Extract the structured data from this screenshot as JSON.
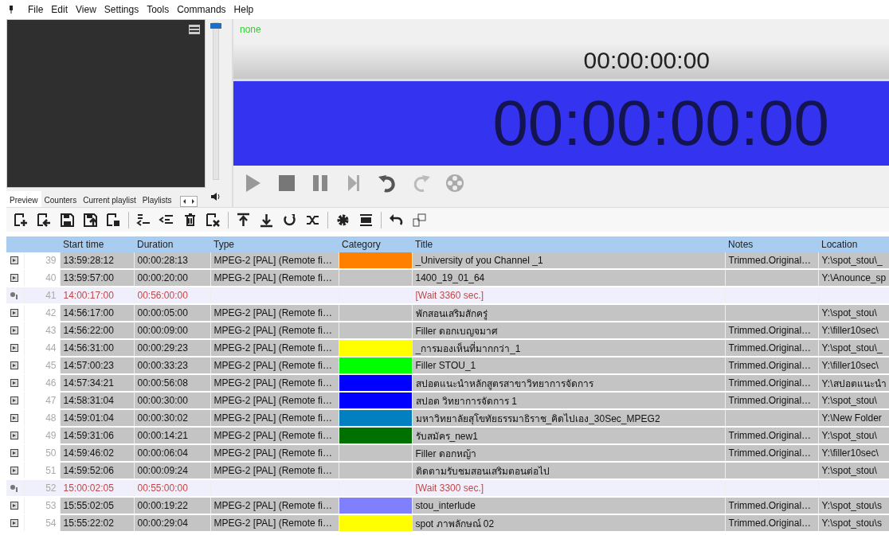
{
  "menu": [
    {
      "label": "File"
    },
    {
      "label": "Edit"
    },
    {
      "label": "View"
    },
    {
      "label": "Settings"
    },
    {
      "label": "Tools"
    },
    {
      "label": "Commands"
    },
    {
      "label": "Help"
    }
  ],
  "preview": {
    "tabs": [
      {
        "label": "Preview",
        "selected": true
      },
      {
        "label": "Counters",
        "selected": false
      },
      {
        "label": "Current playlist",
        "selected": false
      },
      {
        "label": "Playlists",
        "selected": false
      }
    ]
  },
  "volume": {
    "level": 1
  },
  "player": {
    "status": "none",
    "counter": "00:00:00:00",
    "big_counter": "00:00:00:00"
  },
  "table": {
    "columns": [
      "Start time",
      "Duration",
      "Type",
      "Category",
      "Title",
      "Notes",
      "Location"
    ],
    "rows": [
      {
        "kind": "clip",
        "number": "39",
        "start": "13:59:28:12",
        "duration": "00:00:28:13",
        "type": "MPEG-2 [PAL] (Remote fi…",
        "color": "#ff7f00",
        "title": "_University of you Channel _1",
        "notes": "Trimmed.Original…",
        "location": "Y:\\spot_stou\\_"
      },
      {
        "kind": "clip",
        "number": "40",
        "start": "13:59:57:00",
        "duration": "00:00:20:00",
        "type": "MPEG-2 [PAL] (Remote fi…",
        "title": "1400_19_01_64",
        "location": "Y:\\Anounce_sp"
      },
      {
        "kind": "wait",
        "number": "41",
        "start": "14:00:17:00",
        "duration": "00:56:00:00",
        "title": "[Wait 3360 sec.]"
      },
      {
        "kind": "clip",
        "number": "42",
        "start": "14:56:17:00",
        "duration": "00:00:05:00",
        "type": "MPEG-2 [PAL] (Remote fi…",
        "title": "พักสอนเสริมสักครู่",
        "location": "Y:\\spot_stou\\"
      },
      {
        "kind": "clip",
        "number": "43",
        "start": "14:56:22:00",
        "duration": "00:00:09:00",
        "type": "MPEG-2 [PAL] (Remote fi…",
        "title": "Filler ดอกเบญจมาศ",
        "notes": "Trimmed.Original…",
        "location": "Y:\\filler10sec\\"
      },
      {
        "kind": "clip",
        "number": "44",
        "start": "14:56:31:00",
        "duration": "00:00:29:23",
        "type": "MPEG-2 [PAL] (Remote fi…",
        "color": "#ffff00",
        "title": "_การมองเห็นที่มากกว่า_1",
        "notes": "Trimmed.Original…",
        "location": "Y:\\spot_stou\\_"
      },
      {
        "kind": "clip",
        "number": "45",
        "start": "14:57:00:23",
        "duration": "00:00:33:23",
        "type": "MPEG-2 [PAL] (Remote fi…",
        "color": "#00ff00",
        "title": "Filler STOU_1",
        "notes": "Trimmed.Original…",
        "location": "Y:\\filler10sec\\"
      },
      {
        "kind": "clip",
        "number": "46",
        "start": "14:57:34:21",
        "duration": "00:00:56:08",
        "type": "MPEG-2 [PAL] (Remote fi…",
        "color": "#0000ff",
        "title": "สปอตแนะนำหลักสูตรสาขาวิทยาการจัดการ",
        "notes": "Trimmed.Original…",
        "location": "Y:\\สปอตแนะนำ"
      },
      {
        "kind": "clip",
        "number": "47",
        "start": "14:58:31:04",
        "duration": "00:00:30:00",
        "type": "MPEG-2 [PAL] (Remote fi…",
        "color": "#0000ff",
        "title": "สปอต วิทยาการจัดการ 1",
        "notes": "Trimmed.Original…",
        "location": "Y:\\spot_stou\\"
      },
      {
        "kind": "clip",
        "number": "48",
        "start": "14:59:01:04",
        "duration": "00:00:30:02",
        "type": "MPEG-2 [PAL] (Remote fi…",
        "color": "#0080c0",
        "title": "มหาวิทยาลัยสุโขทัยธรรมาธิราช_คิดไปเอง_30Sec_MPEG2",
        "location": "Y:\\New Folder"
      },
      {
        "kind": "clip",
        "number": "49",
        "start": "14:59:31:06",
        "duration": "00:00:14:21",
        "type": "MPEG-2 [PAL] (Remote fi…",
        "color": "#007000",
        "title": "รับสมัคร_new1",
        "notes": "Trimmed.Original…",
        "location": "Y:\\spot_stou\\"
      },
      {
        "kind": "clip",
        "number": "50",
        "start": "14:59:46:02",
        "duration": "00:00:06:04",
        "type": "MPEG-2 [PAL] (Remote fi…",
        "title": "Filler ดอกหญ้า",
        "notes": "Trimmed.Original…",
        "location": "Y:\\filler10sec\\"
      },
      {
        "kind": "clip",
        "number": "51",
        "start": "14:59:52:06",
        "duration": "00:00:09:24",
        "type": "MPEG-2 [PAL] (Remote fi…",
        "title": "ติดตามรับชมสอนเสริมตอนต่อไป",
        "location": "Y:\\spot_stou\\"
      },
      {
        "kind": "wait",
        "number": "52",
        "start": "15:00:02:05",
        "duration": "00:55:00:00",
        "title": "[Wait 3300 sec.]"
      },
      {
        "kind": "clip",
        "number": "53",
        "start": "15:55:02:05",
        "duration": "00:00:19:22",
        "type": "MPEG-2 [PAL] (Remote fi…",
        "color": "#8080ff",
        "title": "stou_interlude",
        "notes": "Trimmed.Original…",
        "location": "Y:\\spot_stou\\s"
      },
      {
        "kind": "clip",
        "number": "54",
        "start": "15:55:22:02",
        "duration": "00:00:29:04",
        "type": "MPEG-2 [PAL] (Remote fi…",
        "color": "#ffff00",
        "title": "spot ภาพลักษณ์ 02",
        "notes": "Trimmed.Original…",
        "location": "Y:\\spot_stou\\s"
      }
    ]
  }
}
